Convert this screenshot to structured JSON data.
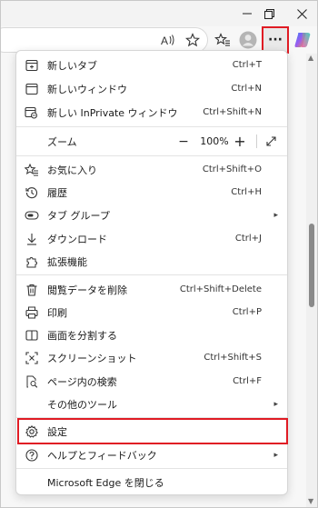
{
  "window_controls": {
    "minimize": "—",
    "restore": "⧉",
    "close": "✕"
  },
  "toolbar": {
    "read_aloud_label": "A",
    "more_label": "···"
  },
  "menu": {
    "items": [
      {
        "label": "新しいタブ",
        "shortcut": "Ctrl+T",
        "icon": "new-tab-icon"
      },
      {
        "label": "新しいウィンドウ",
        "shortcut": "Ctrl+N",
        "icon": "new-window-icon"
      },
      {
        "label": "新しい InPrivate ウィンドウ",
        "shortcut": "Ctrl+Shift+N",
        "icon": "inprivate-window-icon"
      },
      {
        "label": "ズーム",
        "icon": "zoom"
      },
      {
        "label": "お気に入り",
        "shortcut": "Ctrl+Shift+O",
        "icon": "favorites-icon"
      },
      {
        "label": "履歴",
        "shortcut": "Ctrl+H",
        "icon": "history-icon"
      },
      {
        "label": "タブ グループ",
        "icon": "tab-groups-icon",
        "submenu": true
      },
      {
        "label": "ダウンロード",
        "shortcut": "Ctrl+J",
        "icon": "download-icon"
      },
      {
        "label": "拡張機能",
        "icon": "extensions-icon"
      },
      {
        "label": "閲覧データを削除",
        "shortcut": "Ctrl+Shift+Delete",
        "icon": "trash-icon"
      },
      {
        "label": "印刷",
        "shortcut": "Ctrl+P",
        "icon": "print-icon"
      },
      {
        "label": "画面を分割する",
        "icon": "split-screen-icon"
      },
      {
        "label": "スクリーンショット",
        "shortcut": "Ctrl+Shift+S",
        "icon": "screenshot-icon"
      },
      {
        "label": "ページ内の検索",
        "shortcut": "Ctrl+F",
        "icon": "find-in-page-icon"
      },
      {
        "label": "その他のツール",
        "icon": "none",
        "submenu": true
      },
      {
        "label": "設定",
        "icon": "settings-gear-icon"
      },
      {
        "label": "ヘルプとフィードバック",
        "icon": "help-icon",
        "submenu": true
      },
      {
        "label": "Microsoft Edge を閉じる",
        "icon": "none"
      }
    ],
    "zoom": {
      "minus": "−",
      "value": "100%",
      "plus": "+"
    },
    "submenu_arrow": "▸"
  },
  "colors": {
    "highlight": "#e01b24",
    "menu_bg": "#ffffff",
    "window_bg": "#f7f7f7"
  }
}
